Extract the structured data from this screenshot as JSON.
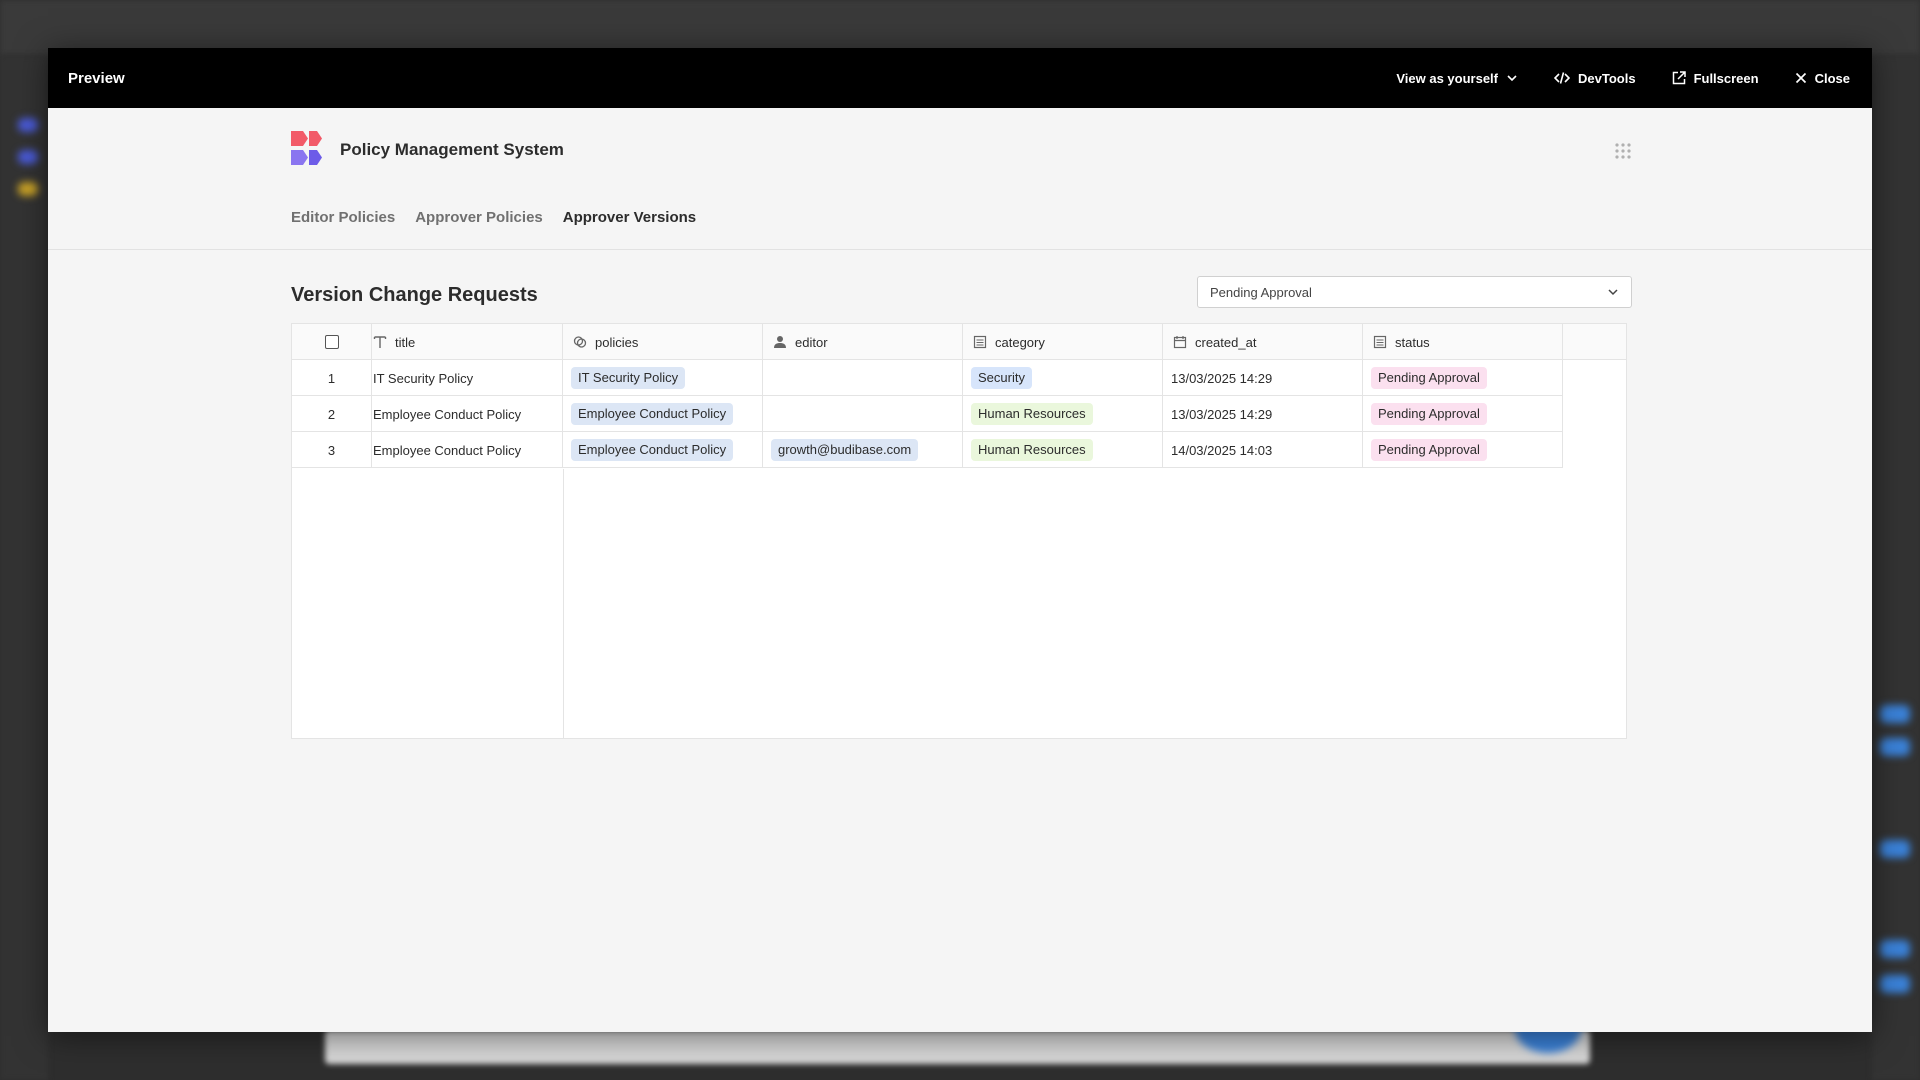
{
  "modal": {
    "title": "Preview",
    "view_as": "View as yourself",
    "devtools": "DevTools",
    "fullscreen": "Fullscreen",
    "close": "Close"
  },
  "app": {
    "name": "Policy Management System",
    "nav": [
      {
        "label": "Editor Policies",
        "active": false
      },
      {
        "label": "Approver Policies",
        "active": false
      },
      {
        "label": "Approver Versions",
        "active": true
      }
    ]
  },
  "section": {
    "title": "Version Change Requests",
    "filter_value": "Pending Approval"
  },
  "table": {
    "columns": [
      "title",
      "policies",
      "editor",
      "category",
      "created_at",
      "status"
    ],
    "rows": [
      {
        "num": "1",
        "title": "IT Security Policy",
        "policies": "IT Security Policy",
        "editor": "",
        "category": "Security",
        "created_at": "13/03/2025 14:29",
        "status": "Pending Approval"
      },
      {
        "num": "2",
        "title": "Employee Conduct Policy",
        "policies": "Employee Conduct Policy",
        "editor": "",
        "category": "Human Resources",
        "created_at": "13/03/2025 14:29",
        "status": "Pending Approval"
      },
      {
        "num": "3",
        "title": "Employee Conduct Policy",
        "policies": "Employee Conduct Policy",
        "editor": "growth@budibase.com",
        "category": "Human Resources",
        "created_at": "14/03/2025 14:03",
        "status": "Pending Approval"
      }
    ]
  },
  "colors": {
    "modal_bar": "#000000",
    "logo_red": "#f25a68",
    "logo_purple": "#8a75f0",
    "pill_policy": "#dce6f5",
    "pill_security": "#d7e5fb",
    "pill_hr": "#eaf7dc",
    "pill_pending": "#fbe0ef"
  },
  "icons": {
    "title_col": "text-icon",
    "policies_col": "link-icon",
    "editor_col": "user-icon",
    "category_col": "options-icon",
    "created_col": "calendar-icon",
    "status_col": "options-icon"
  }
}
